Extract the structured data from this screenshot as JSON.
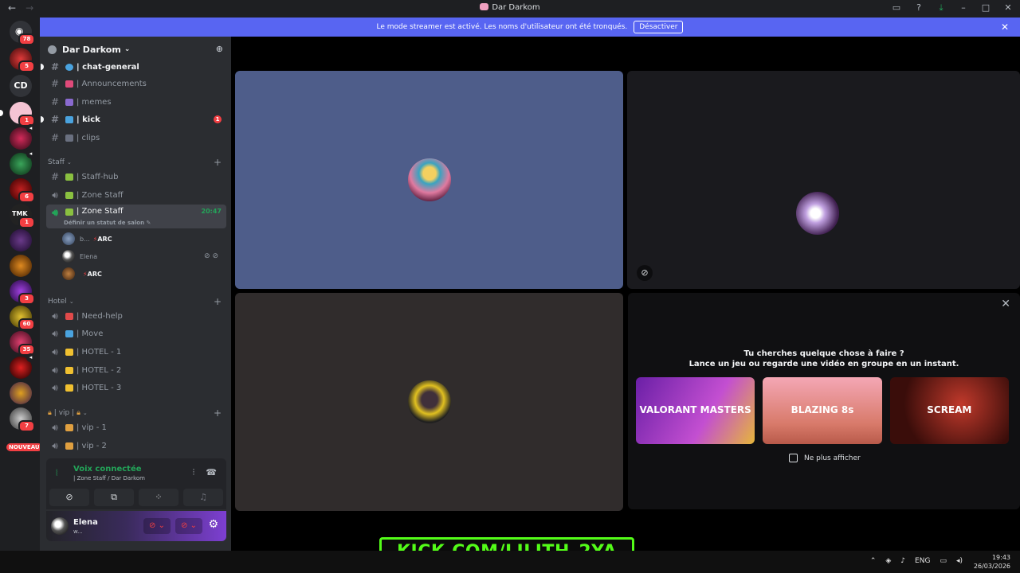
{
  "window": {
    "title": "Dar Darkom",
    "back_icon": "arrow-left-icon",
    "forward_icon": "arrow-right-icon"
  },
  "banner": {
    "text": "Le mode streamer est activé. Les noms d'utilisateur ont été tronqués.",
    "button": "Désactiver"
  },
  "rail": {
    "home_badge": "78",
    "servers": [
      {
        "badge": "5"
      },
      {
        "label": "CD"
      },
      {
        "badge": "1"
      },
      {
        "badge": ""
      },
      {
        "badge": ""
      },
      {
        "badge": "6"
      },
      {
        "badge": "1"
      },
      {
        "badge": ""
      },
      {
        "badge": ""
      },
      {
        "badge": "3"
      },
      {
        "badge": "60"
      },
      {
        "badge": "35"
      },
      {
        "badge": ""
      },
      {
        "badge": ""
      },
      {
        "badge": "7"
      }
    ],
    "new_label": "NOUVEAU"
  },
  "guild": {
    "name": "Dar Darkom"
  },
  "channels": {
    "chat_general": "| chat-general",
    "announcements": "| Announcements",
    "memes": "| memes",
    "kick": "| kick",
    "kick_mentions": "1",
    "clips": "| clips",
    "cat_staff": "Staff",
    "staff_hub": "| Staff-hub",
    "zone_staff_1": "| Zone Staff",
    "zone_staff_2": "| Zone Staff",
    "zone_staff_time": "20:47",
    "zone_staff_status": "Définir un statut de salon",
    "voice_users": [
      {
        "name": "b...",
        "tag": "ARC"
      },
      {
        "name": "Elena",
        "tag": ""
      },
      {
        "name": "",
        "tag": "ARC"
      }
    ],
    "cat_hotel": "Hotel",
    "need_help": "| Need-help",
    "move": "| Move",
    "hotel_1": "| HOTEL - 1",
    "hotel_2": "| HOTEL - 2",
    "hotel_3": "| HOTEL - 3",
    "cat_vip": "| vip |",
    "vip_1": "| vip - 1",
    "vip_2": "| vip - 2"
  },
  "voice_panel": {
    "status": "Voix connectée",
    "location": "| Zone Staff / Dar Darkom"
  },
  "user": {
    "name": "Elena",
    "status": "w..."
  },
  "activity": {
    "title_line1": "Tu cherches quelque chose à faire ?",
    "title_line2": "Lance un jeu ou regarde une vidéo en groupe en un instant.",
    "cards": [
      "VALORANT MASTERS",
      "BLAZING 8s",
      "SCREAM"
    ],
    "dont_show": "Ne plus afficher"
  },
  "watermark": "KICK.COM/LILITH_2YA",
  "taskbar": {
    "lang": "ENG",
    "time": "19:43",
    "date": "26/03/2026"
  },
  "colors": {
    "accent": "#5865f2",
    "online": "#23a559",
    "danger": "#f23f43",
    "kick_green": "#53fc18"
  }
}
